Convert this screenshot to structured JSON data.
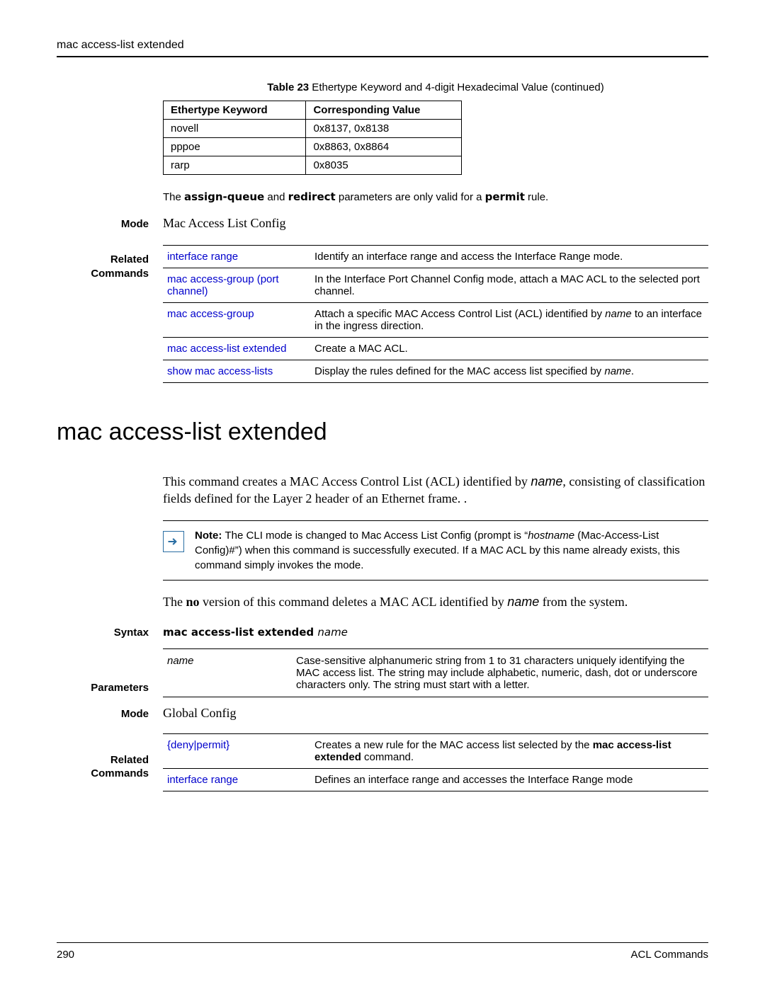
{
  "header": "mac access-list extended",
  "table23": {
    "caption_label": "Table 23",
    "caption_text": "  Ethertype Keyword and 4-digit Hexadecimal Value (continued)",
    "col1": "Ethertype Keyword",
    "col2": "Corresponding Value",
    "rows": [
      {
        "k": "novell",
        "v": "0x8137, 0x8138"
      },
      {
        "k": "pppoe",
        "v": "0x8863, 0x8864"
      },
      {
        "k": "rarp",
        "v": "0x8035"
      }
    ]
  },
  "para1": {
    "pre": "The ",
    "cmd1": "assign-queue",
    "mid": " and ",
    "cmd2": "redirect",
    "post": " parameters are only valid for a ",
    "cmd3": "permit",
    "end": " rule."
  },
  "labels": {
    "mode": "Mode",
    "related": "Related Commands",
    "syntax": "Syntax",
    "parameters": "Parameters"
  },
  "mode1": "Mac Access List Config",
  "related1": [
    {
      "link": "interface range",
      "desc": "Identify an interface range and access the Interface Range mode."
    },
    {
      "link": "mac access-group (port channel)",
      "desc": "In the Interface Port Channel Config mode, attach a MAC ACL to the selected port channel."
    },
    {
      "link": "mac access-group",
      "desc_pre": "Attach a specific MAC Access Control List (ACL) identified by ",
      "desc_ital": "name",
      "desc_post": " to an interface in the ingress direction."
    },
    {
      "link": "mac access-list extended",
      "desc": "Create a MAC ACL."
    },
    {
      "link": "show mac access-lists",
      "desc_pre": "Display the rules defined for the MAC access list specified by ",
      "desc_ital": "name",
      "desc_post": "."
    }
  ],
  "h1": "mac access-list extended",
  "body1": {
    "pre": "This command creates a MAC Access Control List (ACL) identified by ",
    "ital": "name",
    "post": ", consisting of classification fields defined for the Layer 2 header of an Ethernet frame. ."
  },
  "note": {
    "bold": "Note: ",
    "pre": "The CLI mode is changed to Mac Access List Config (prompt is “",
    "ital": "hostname",
    "post": " (Mac-Access-List Config)#”) when this command is successfully executed. If a MAC ACL by this name already exists, this command simply invokes the mode."
  },
  "body2": {
    "pre": "The ",
    "bold": "no",
    "mid": " version of this command deletes a MAC ACL identified by ",
    "ital": "name",
    "post": " from the system."
  },
  "syntax": {
    "cmd": "mac access-list extended ",
    "param": "name"
  },
  "params": [
    {
      "name": "name",
      "desc": "Case-sensitive alphanumeric string from 1 to 31 characters uniquely identifying the MAC access list. The string may include alphabetic, numeric, dash, dot or underscore characters only. The string must start with a letter."
    }
  ],
  "mode2": "Global Config",
  "related2": [
    {
      "link": "{deny|permit}",
      "desc_pre": "Creates a new rule for the MAC access list selected by the ",
      "desc_bold": "mac access-list extended",
      "desc_post": " command."
    },
    {
      "link": "interface range",
      "desc": "Defines an interface range and accesses the Interface Range mode"
    }
  ],
  "footer": {
    "page": "290",
    "section": "ACL Commands"
  }
}
